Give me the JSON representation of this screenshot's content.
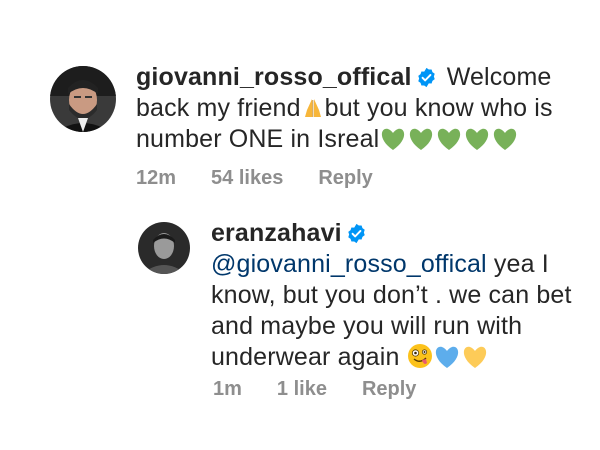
{
  "comments": [
    {
      "username": "giovanni_rosso_offical",
      "avatar_icon": "avatar-man-beard-icon",
      "verified_icon": "verified-badge-icon",
      "text_part1": "Welcome back my friend",
      "text_part2": "but you know who is number ONE in Isreal",
      "emojis": [
        "folded-hands-icon",
        "green-heart-icon",
        "green-heart-icon",
        "green-heart-icon",
        "green-heart-icon",
        "green-heart-icon"
      ],
      "time": "12m",
      "likes": "54 likes",
      "reply_label": "Reply"
    },
    {
      "username": "eranzahavi",
      "avatar_icon": "avatar-man-icon",
      "verified_icon": "verified-badge-icon",
      "mention": "@giovanni_rosso_offical",
      "text": "yea I know, but you don’t . we can bet and maybe you will run with underwear again",
      "emojis": [
        "zany-face-icon",
        "blue-heart-icon",
        "yellow-heart-icon"
      ],
      "time": "1m",
      "likes": "1 like",
      "reply_label": "Reply"
    }
  ],
  "colors": {
    "text": "#262626",
    "meta": "#8e8e8e",
    "verified": "#0095f6",
    "mention": "#00376b",
    "green_heart": "#78b159",
    "blue_heart": "#5dadec",
    "yellow_heart": "#fdcb58"
  }
}
